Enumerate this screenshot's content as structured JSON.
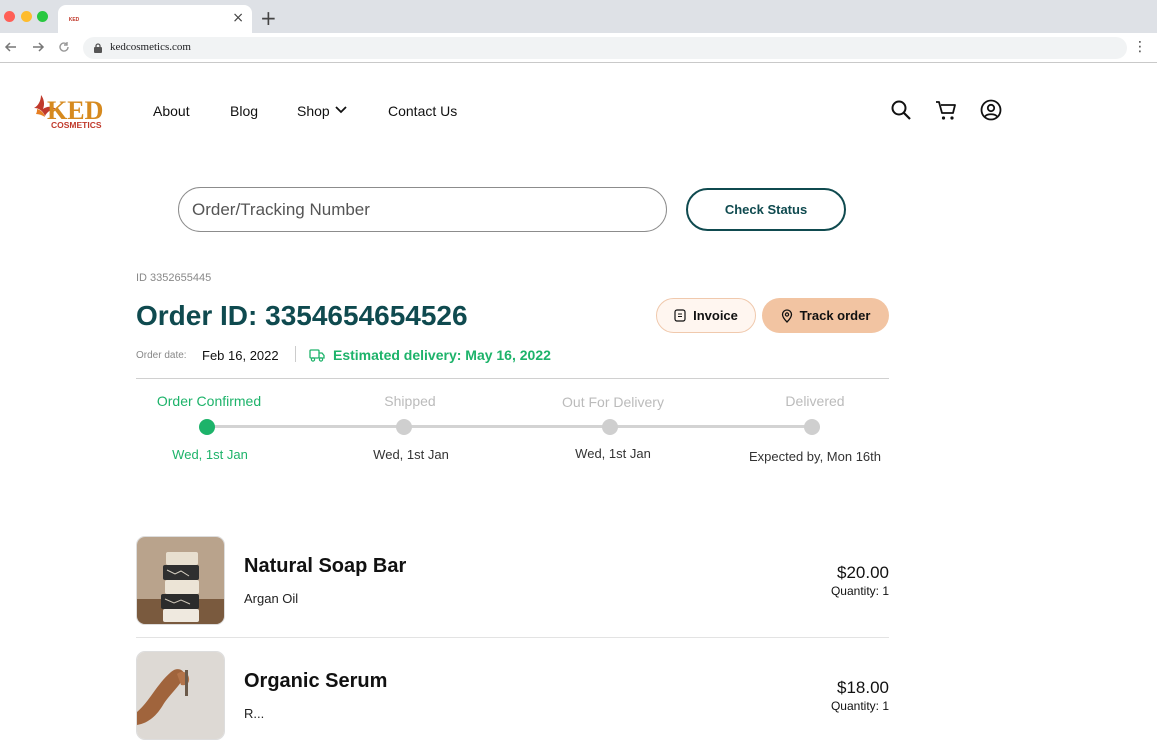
{
  "browser": {
    "url": "kedcosmetics.com",
    "close_glyph": "×",
    "new_tab_glyph": "+",
    "menu_glyph": "⋮"
  },
  "logo": {
    "text_main": "KED",
    "text_sub": "COSMETICS"
  },
  "nav": {
    "about": "About",
    "blog": "Blog",
    "shop": "Shop",
    "contact": "Contact Us"
  },
  "tracking": {
    "placeholder": "Order/Tracking Number",
    "value": "",
    "button": "Check Status"
  },
  "order": {
    "small_id": "ID 3352655445",
    "title": "Order ID: 3354654654526",
    "invoice_label": "Invoice",
    "track_label": "Track order",
    "date_label": "Order date:",
    "date_value": "Feb 16, 2022",
    "estimated": "Estimated delivery: May 16, 2022"
  },
  "progress": {
    "completed_fraction": 0,
    "steps": [
      {
        "name": "Order Confirmed",
        "date": "Wed, 1st Jan",
        "active": true
      },
      {
        "name": "Shipped",
        "date": "Wed, 1st Jan",
        "active": false
      },
      {
        "name": "Out For Delivery",
        "date": "Wed, 1st Jan",
        "active": false
      },
      {
        "name": "Delivered",
        "date": "Expected by, Mon 16th",
        "active": false
      }
    ]
  },
  "items": [
    {
      "name": "Natural Soap Bar",
      "variant": "Argan Oil",
      "price": "$20.00",
      "quantity": "Quantity: 1"
    },
    {
      "name": "Organic Serum",
      "variant": "R...",
      "price": "$18.00",
      "quantity": "Quantity: 1"
    }
  ],
  "colors": {
    "brand_dark": "#0f4a4f",
    "success": "#1db36a",
    "accent_peach": "#f2c4a2"
  }
}
